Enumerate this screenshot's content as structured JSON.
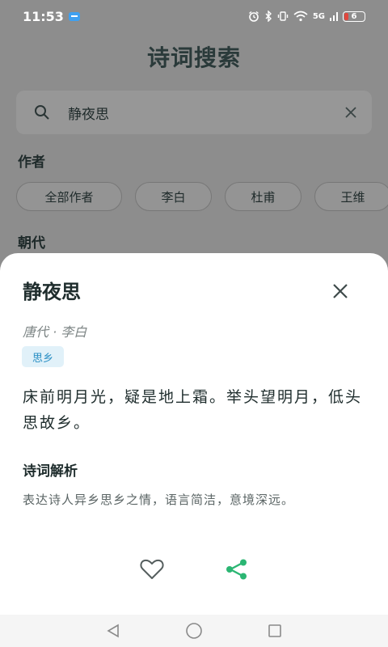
{
  "status_bar": {
    "time": "11:53",
    "network_label": "5G",
    "battery_level": "6"
  },
  "page": {
    "title": "诗词搜索",
    "search": {
      "value": "静夜思",
      "placeholder": ""
    },
    "author_section_label": "作者",
    "author_chips": [
      "全部作者",
      "李白",
      "杜甫",
      "王维"
    ],
    "dynasty_section_label": "朝代"
  },
  "detail_sheet": {
    "title": "静夜思",
    "meta": "唐代 · 李白",
    "tag": "思乡",
    "poem_text": "床前明月光，疑是地上霜。举头望明月，低头思故乡。",
    "analysis_title": "诗词解析",
    "analysis_text": "表达诗人异乡思乡之情，语言简洁，意境深远。"
  },
  "icons": {
    "search": "search-icon",
    "clear": "close-icon",
    "close_sheet": "close-icon",
    "like": "heart-outline-icon",
    "share": "share-icon",
    "nav_back": "triangle-back-icon",
    "nav_home": "circle-home-icon",
    "nav_recents": "square-recents-icon"
  },
  "colors": {
    "accent_green": "#2bb673",
    "tag_background": "#e1f1f9",
    "tag_text": "#2a8fc4",
    "battery_low": "#e0483e"
  }
}
